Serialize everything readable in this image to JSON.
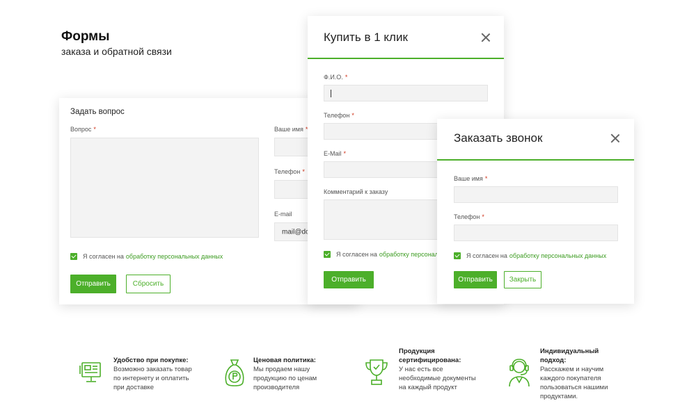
{
  "hero": {
    "title": "Формы",
    "subtitle": "заказа и обратной связи"
  },
  "ask_form": {
    "title": "Задать вопрос",
    "question_label": "Вопрос",
    "name_label": "Ваше имя",
    "phone_label": "Телефон",
    "email_label": "E-mail",
    "email_value": "mail@do",
    "required_mark": "*",
    "consent_text": "Я согласен на",
    "consent_link": "обработку персональных данных",
    "submit_label": "Отправить",
    "reset_label": "Сбросить"
  },
  "buy_modal": {
    "title": "Купить в 1 клик",
    "fio_label": "Ф.И.О.",
    "phone_label": "Телефон",
    "email_label": "E-Mail",
    "comment_label": "Комментарий к заказу",
    "required_mark": "*",
    "consent_text": "Я согласен на",
    "consent_link": "обработку персональ",
    "submit_label": "Отправить"
  },
  "call_modal": {
    "title": "Заказать звонок",
    "name_label": "Ваше имя",
    "phone_label": "Телефон",
    "required_mark": "*",
    "consent_text": "Я согласен на",
    "consent_link": "обработку персональных данных",
    "submit_label": "Отправить",
    "close_label": "Закрыть"
  },
  "features": [
    {
      "icon": "computer-icon",
      "title": "Удобство при покупке:",
      "text": "Возможно заказать товар по интернету и оплатить при доставке"
    },
    {
      "icon": "money-bag-icon",
      "title": "Ценовая политика:",
      "text": "Мы продаем нашу продукцию по ценам производителя"
    },
    {
      "icon": "trophy-icon",
      "title": "Продукция сертифицирована:",
      "text": "У нас есть все необходимые документы на каждый продукт"
    },
    {
      "icon": "support-operator-icon",
      "title": "Индивидуальный подход:",
      "text": "Расскажем и научим каждого покупателя пользоваться нашими продуктами."
    }
  ],
  "colors": {
    "accent": "#4caf2a",
    "required": "#d0341c"
  }
}
